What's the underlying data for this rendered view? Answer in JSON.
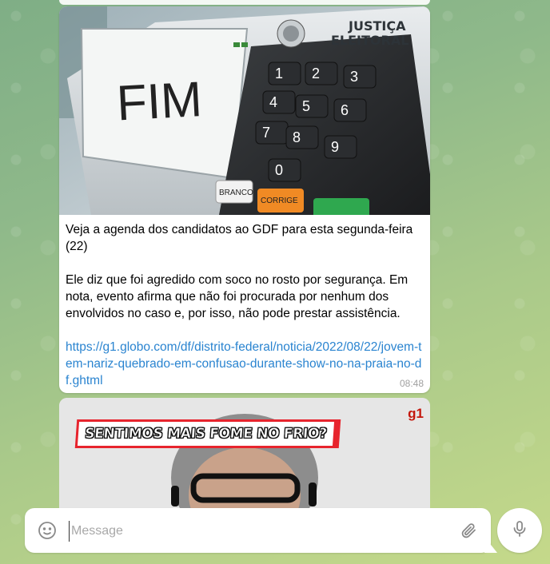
{
  "message1": {
    "image": {
      "screen_text": "FIM",
      "brand_line1": "JUSTIÇA",
      "brand_line2": "ELEITORAL",
      "keys": [
        "1",
        "2",
        "3",
        "4",
        "5",
        "6",
        "7",
        "8",
        "9",
        "0"
      ],
      "key_branco": "BRANCO",
      "key_corrige": "CORRIGE"
    },
    "title": "Veja a agenda dos candidatos ao GDF para esta segunda-feira (22)",
    "body": "Ele diz que foi agredido com soco no rosto por segurança. Em nota, evento afirma que não foi procurada por nenhum dos envolvidos no caso e, por isso, não pode prestar assistência.",
    "link": "https://g1.globo.com/df/distrito-federal/noticia/2022/08/22/jovem-tem-nariz-quebrado-em-confusao-durante-show-no-na-praia-no-df.ghtml",
    "time": "08:48"
  },
  "message2": {
    "banner_text": "SENTIMOS MAIS FOME NO FRIO?",
    "logo": "g1"
  },
  "composer": {
    "placeholder": "Message",
    "value": ""
  },
  "icons": {
    "emoji": "emoji-icon",
    "attach": "paperclip-icon",
    "mic": "microphone-icon"
  },
  "colors": {
    "link": "#2a84d0",
    "banner_red": "#e7242d",
    "g1_red": "#c4170c"
  }
}
